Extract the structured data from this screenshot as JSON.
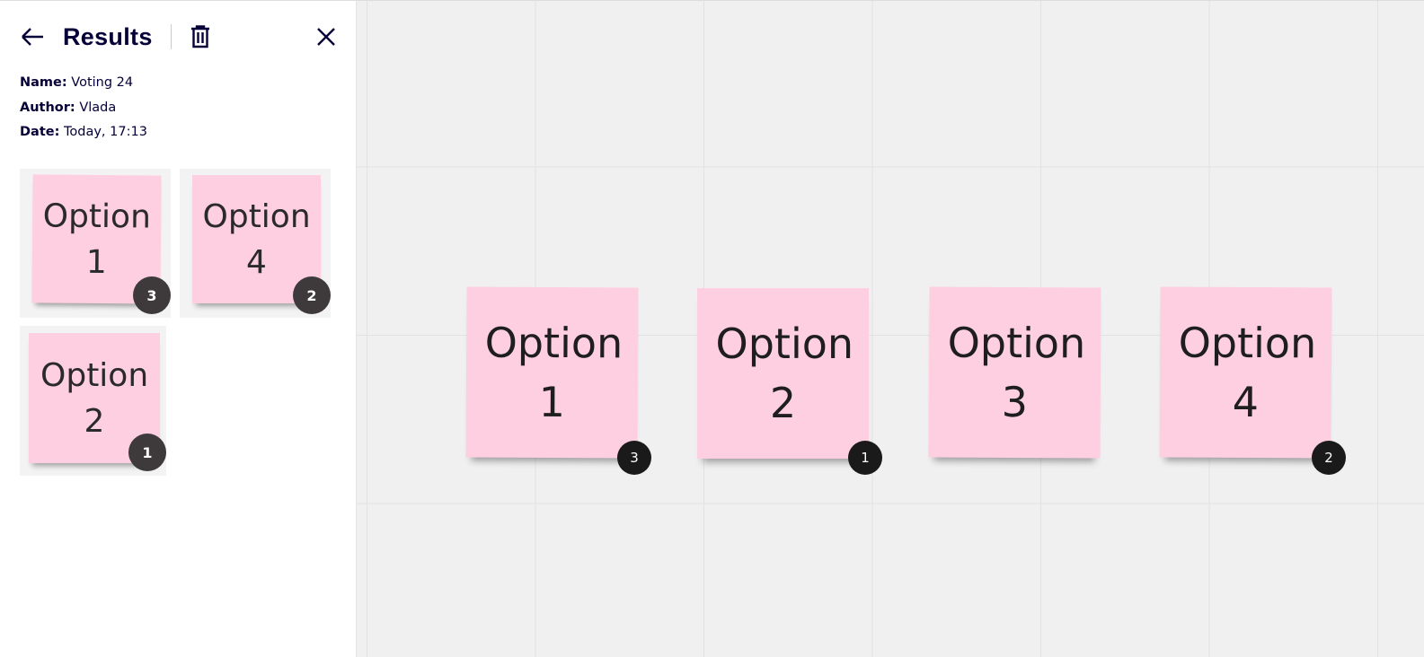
{
  "panel": {
    "title": "Results",
    "icons": {
      "back": "arrow-left-icon",
      "delete": "trash-icon",
      "close": "close-icon"
    },
    "meta": [
      {
        "label": "Name:",
        "value": "Voting 24"
      },
      {
        "label": "Author:",
        "value": "Vlada"
      },
      {
        "label": "Date:",
        "value": "Today, 17:13"
      }
    ],
    "results": [
      {
        "text": "Option 1",
        "votes": "3"
      },
      {
        "text": "Option 4",
        "votes": "2"
      },
      {
        "text": "Option 2",
        "votes": "1"
      }
    ]
  },
  "board": {
    "notes": [
      {
        "text": "Option 1",
        "votes": "3"
      },
      {
        "text": "Option 2",
        "votes": "1"
      },
      {
        "text": "Option 3",
        "votes": ""
      },
      {
        "text": "Option 4",
        "votes": "2"
      }
    ]
  },
  "colors": {
    "note": "#fecfe0",
    "text": "#050038",
    "badge": "#1a1a1a"
  }
}
